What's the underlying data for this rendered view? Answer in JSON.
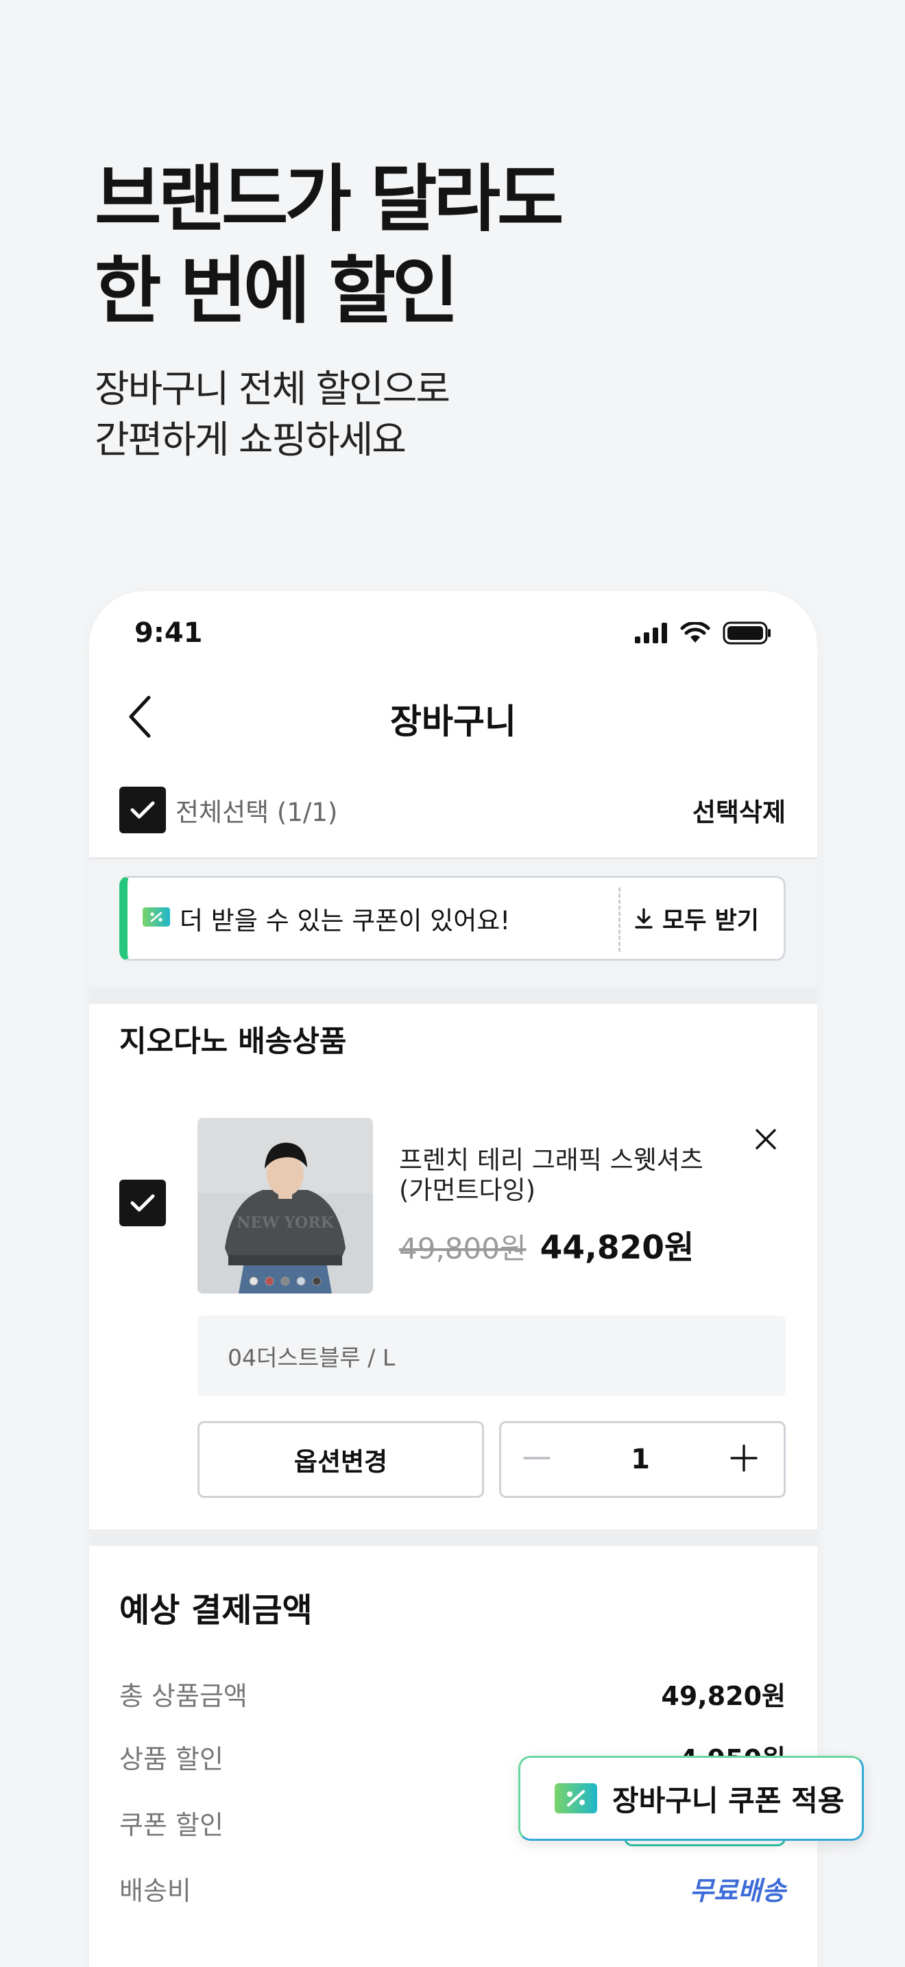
{
  "hero": {
    "line1": "브랜드가 달라도",
    "line2": "한 번에 할인",
    "sub1": "장바구니 전체 할인으로",
    "sub2": "간편하게 쇼핑하세요"
  },
  "status_bar": {
    "time": "9:41"
  },
  "nav": {
    "title": "장바구니"
  },
  "select_all": {
    "label": "전체선택 (1/1)",
    "checked": true,
    "delete_label": "선택삭제"
  },
  "coupon_banner": {
    "text": "더 받을 수 있는 쿠폰이 있어요!",
    "download_label": "모두 받기"
  },
  "brand_section": {
    "title": "지오다노 배송상품"
  },
  "cart_item": {
    "checked": true,
    "name": "프렌치 테리 그래픽 스웻셔츠 (가먼트다잉)",
    "original_price": "49,800원",
    "sale_price": "44,820원",
    "option": "04더스트블루 / L",
    "change_option_label": "옵션변경",
    "quantity": "1",
    "image_print": "NEW YORK"
  },
  "payment": {
    "title": "예상 결제금액",
    "rows": [
      {
        "label": "총 상품금액",
        "value": "49,820원"
      },
      {
        "label": "상품 할인",
        "value": "4,950원"
      },
      {
        "label": "쿠폰 할인",
        "value": ""
      },
      {
        "label": "배송비",
        "value": "무료배송"
      }
    ]
  },
  "float_button": {
    "label": "장바구니 쿠폰 적용"
  },
  "colors": {
    "accent_green": "#27c67d",
    "accent_blue": "#3d6cd9",
    "checkbox": "#151515"
  }
}
